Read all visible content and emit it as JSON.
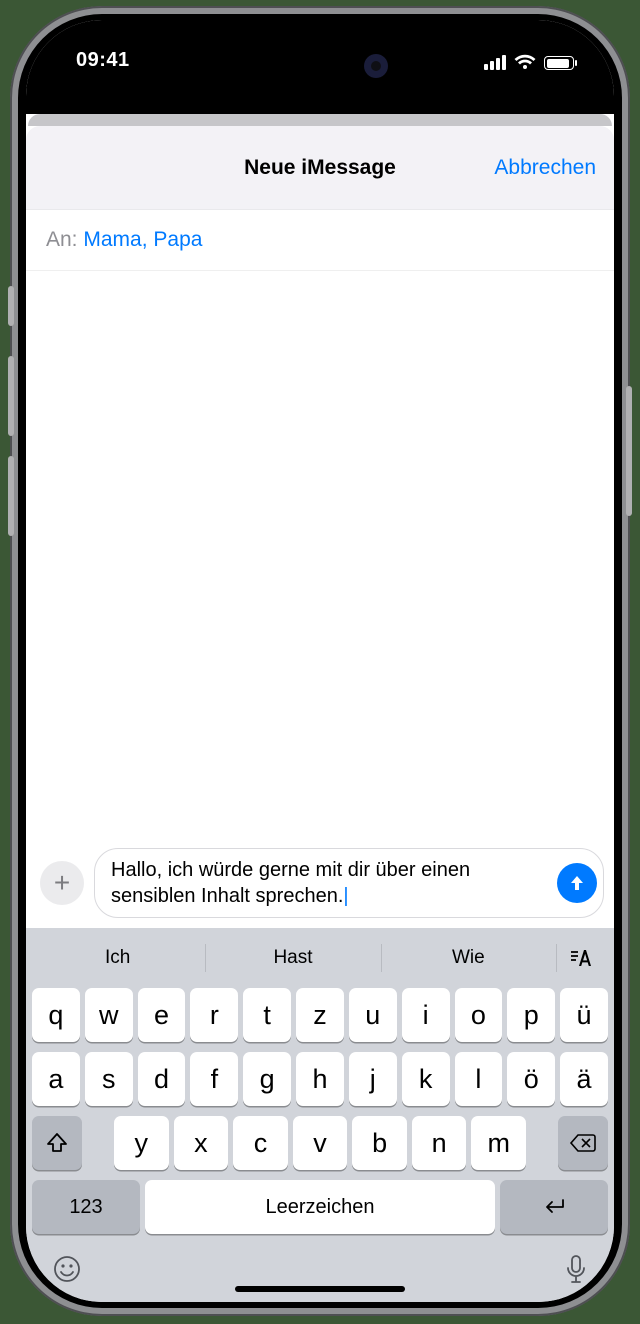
{
  "statusbar": {
    "time": "09:41"
  },
  "header": {
    "title": "Neue iMessage",
    "cancel": "Abbrechen"
  },
  "recipients": {
    "label": "An:",
    "names": "Mama, Papa"
  },
  "compose": {
    "text": "Hallo, ich würde gerne mit dir über einen sensiblen Inhalt sprechen."
  },
  "suggestions": [
    "Ich",
    "Hast",
    "Wie"
  ],
  "keys": {
    "row1": [
      "q",
      "w",
      "e",
      "r",
      "t",
      "z",
      "u",
      "i",
      "o",
      "p",
      "ü"
    ],
    "row2": [
      "a",
      "s",
      "d",
      "f",
      "g",
      "h",
      "j",
      "k",
      "l",
      "ö",
      "ä"
    ],
    "row3": [
      "y",
      "x",
      "c",
      "v",
      "b",
      "n",
      "m"
    ],
    "numkey": "123",
    "space": "Leerzeichen"
  }
}
